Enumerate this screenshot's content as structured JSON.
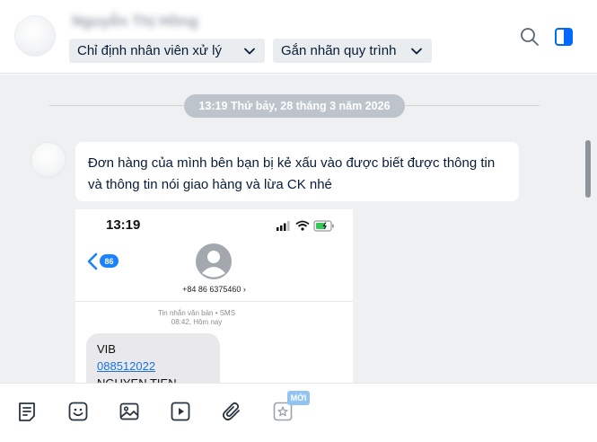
{
  "header": {
    "contact_name": "Nguyễn Thị Hồng",
    "assign_staff_label": "Chỉ định nhân viên xử lý",
    "process_tag_label": "Gắn nhãn quy trình",
    "icons": [
      "search-icon",
      "sidebar-toggle-icon"
    ],
    "accent_color": "#0068ff"
  },
  "chat": {
    "date_separator": "13:19 Thứ bảy, 28 tháng 3 năm 2026",
    "message": {
      "line1": "Đơn hàng của mình bên bạn bị kẻ xấu vào được biết được thông tin",
      "line2": "và thông tin nói giao hàng và lừa CK nhé"
    },
    "attached_screenshot": {
      "time": "13:19",
      "back_badge": "86",
      "sender_number": "+84 86 6375460 ›",
      "sms_label": "Tin nhắn văn bản • SMS",
      "sms_time": "08:42, Hôm nay",
      "sms_lines": [
        "VIB",
        "088512022",
        "NGUYEN TIEN DUNG"
      ]
    }
  },
  "toolbar": {
    "icons": [
      "note-icon",
      "sticker-icon",
      "image-icon",
      "video-icon",
      "attachment-icon",
      "quick-message-icon"
    ],
    "new_badge": "MỚI"
  }
}
